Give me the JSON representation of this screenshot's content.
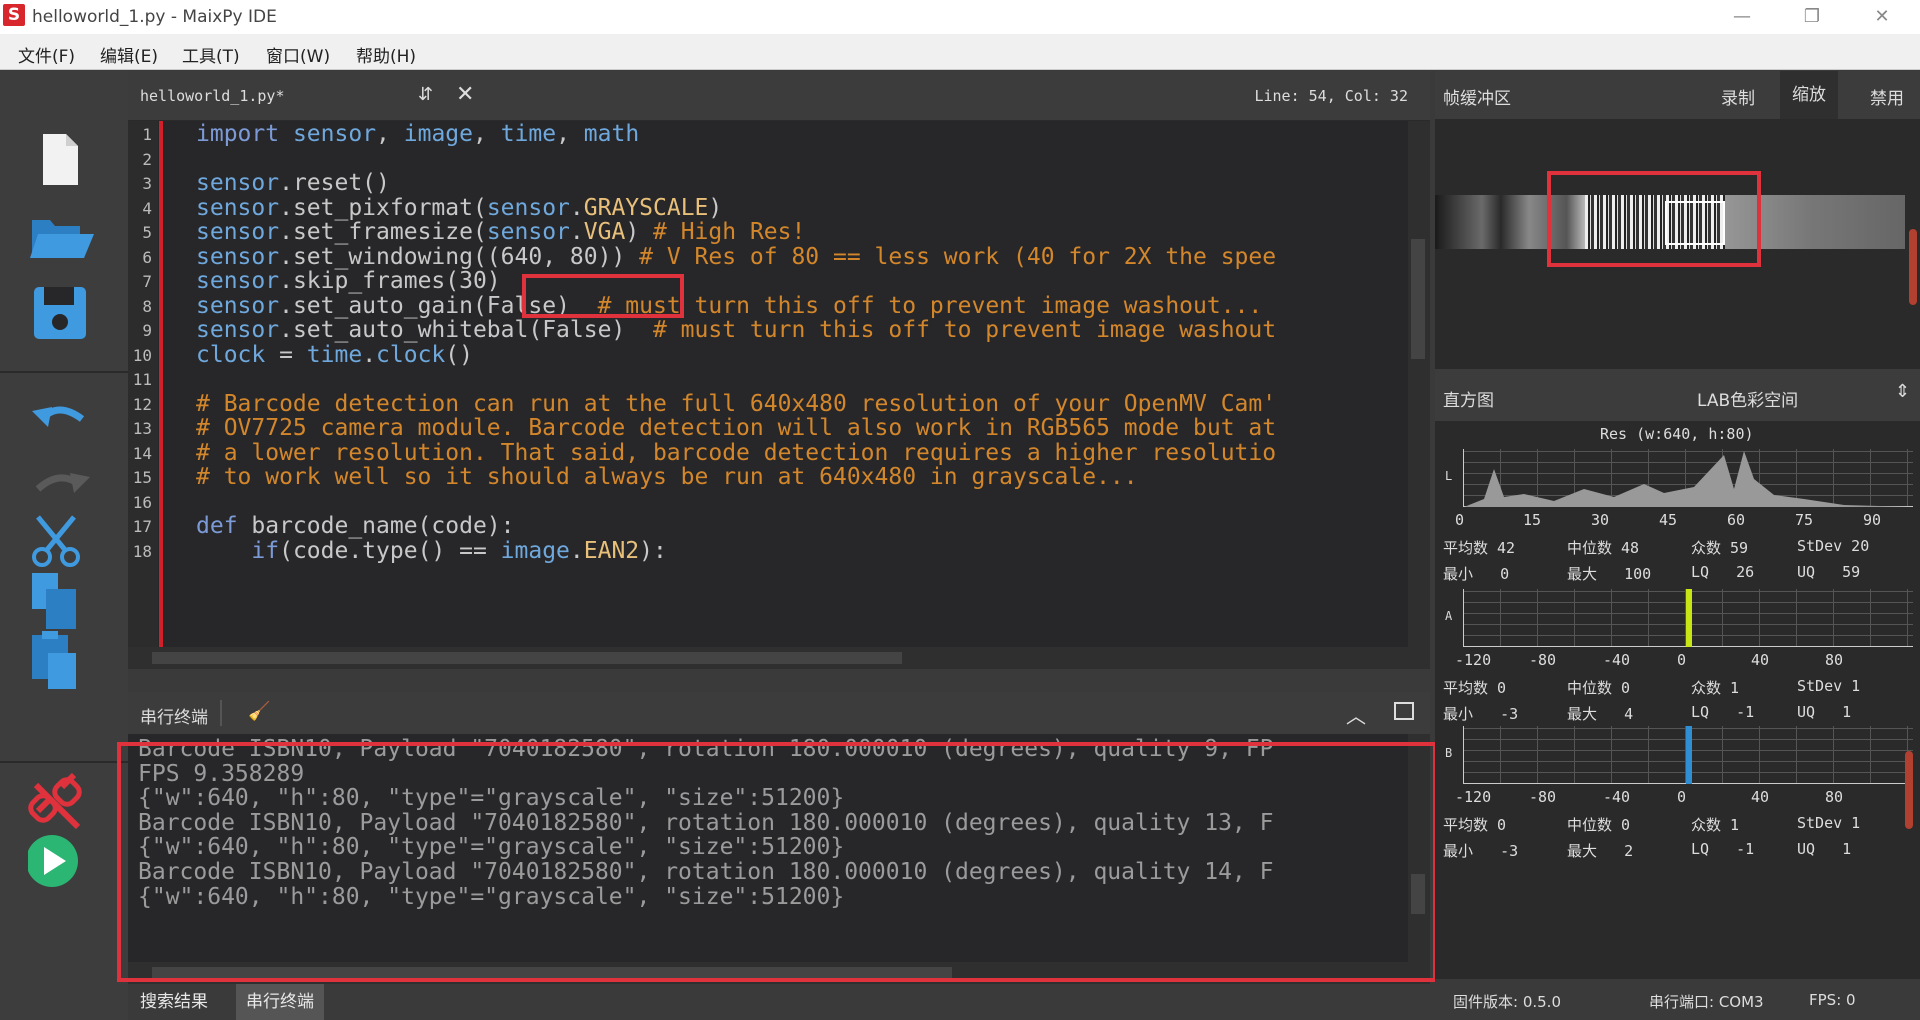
{
  "window": {
    "title": "helloworld_1.py - MaixPy IDE",
    "app_icon": "S"
  },
  "menu": [
    "文件(F)",
    "编辑(E)",
    "工具(T)",
    "窗口(W)",
    "帮助(H)"
  ],
  "toolbar": {
    "icons": [
      "new-file-icon",
      "open-folder-icon",
      "save-icon",
      "undo-icon",
      "redo-icon",
      "cut-icon",
      "copy-icon",
      "paste-icon",
      "disconnect-icon",
      "run-icon"
    ]
  },
  "editor": {
    "filename": "helloworld_1.py*",
    "position": "Line: 54, Col: 32",
    "line_numbers": [
      "1",
      "2",
      "3",
      "4",
      "5",
      "6",
      "7",
      "8",
      "9",
      "10",
      "11",
      "12",
      "13",
      "14",
      "15",
      "16",
      "17",
      "18"
    ],
    "lines": [
      "import sensor, image, time, math",
      "",
      "sensor.reset()",
      "sensor.set_pixformat(sensor.GRAYSCALE)",
      "sensor.set_framesize(sensor.VGA) # High Res!",
      "sensor.set_windowing((640, 80)) # V Res of 80 == less work (40 for 2X the spee",
      "sensor.skip_frames(30)",
      "sensor.set_auto_gain(False)  # must turn this off to prevent image washout...",
      "sensor.set_auto_whitebal(False)  # must turn this off to prevent image washout",
      "clock = time.clock()",
      "",
      "# Barcode detection can run at the full 640x480 resolution of your OpenMV Cam'",
      "# OV7725 camera module. Barcode detection will also work in RGB565 mode but at",
      "# a lower resolution. That said, barcode detection requires a higher resolutio",
      "# to work well so it should always be run at 640x480 in grayscale...",
      "",
      "def barcode_name(code):",
      "    if(code.type() == image.EAN2):"
    ]
  },
  "serial": {
    "title": "串行终端",
    "lines": [
      "Barcode ISBN10, Payload \"7040182580\", rotation 180.000010 (degrees), quality 9, FP",
      "FPS 9.358289",
      "{\"w\":640, \"h\":80, \"type\"=\"grayscale\", \"size\":51200}",
      "Barcode ISBN10, Payload \"7040182580\", rotation 180.000010 (degrees), quality 13, F",
      "{\"w\":640, \"h\":80, \"type\"=\"grayscale\", \"size\":51200}",
      "Barcode ISBN10, Payload \"7040182580\", rotation 180.000010 (degrees), quality 14, F",
      "{\"w\":640, \"h\":80, \"type\"=\"grayscale\", \"size\":51200}"
    ]
  },
  "bottom_tabs": [
    "搜索结果",
    "串行终端"
  ],
  "framebuffer": {
    "title": "帧缓冲区",
    "buttons": [
      "录制",
      "缩放",
      "禁用"
    ],
    "active": "缩放"
  },
  "histogram": {
    "title": "直方图",
    "colorspace": "LAB色彩空间",
    "resolution": "Res (w:640, h:80)",
    "channels": [
      {
        "label": "L",
        "ticks": [
          "0",
          "15",
          "30",
          "45",
          "60",
          "75",
          "90"
        ],
        "stats": {
          "mean": "平均数 42",
          "median": "中位数 48",
          "mode": "众数 59",
          "stdev": "StDev 20",
          "min": "最小   0",
          "max": "最大   100",
          "lq": "LQ   26",
          "uq": "UQ   59"
        }
      },
      {
        "label": "A",
        "ticks": [
          "-120",
          "-80",
          "-40",
          "0",
          "40",
          "80"
        ],
        "stats": {
          "mean": "平均数 0",
          "median": "中位数 0",
          "mode": "众数 1",
          "stdev": "StDev 1",
          "min": "最小   -3",
          "max": "最大   4",
          "lq": "LQ   -1",
          "uq": "UQ   1"
        }
      },
      {
        "label": "B",
        "ticks": [
          "-120",
          "-80",
          "-40",
          "0",
          "40",
          "80"
        ],
        "stats": {
          "mean": "平均数 0",
          "median": "中位数 0",
          "mode": "众数 1",
          "stdev": "StDev 1",
          "min": "最小   -3",
          "max": "最大   2",
          "lq": "LQ   -1",
          "uq": "UQ   1"
        }
      }
    ]
  },
  "status": {
    "firmware": "固件版本: 0.5.0",
    "port": "串行端口: COM3",
    "fps": "FPS: 0"
  },
  "colors": {
    "highlight_box": "#e0323c",
    "accent_green": "#2bb673",
    "accent_blue": "#2f8fd5"
  }
}
